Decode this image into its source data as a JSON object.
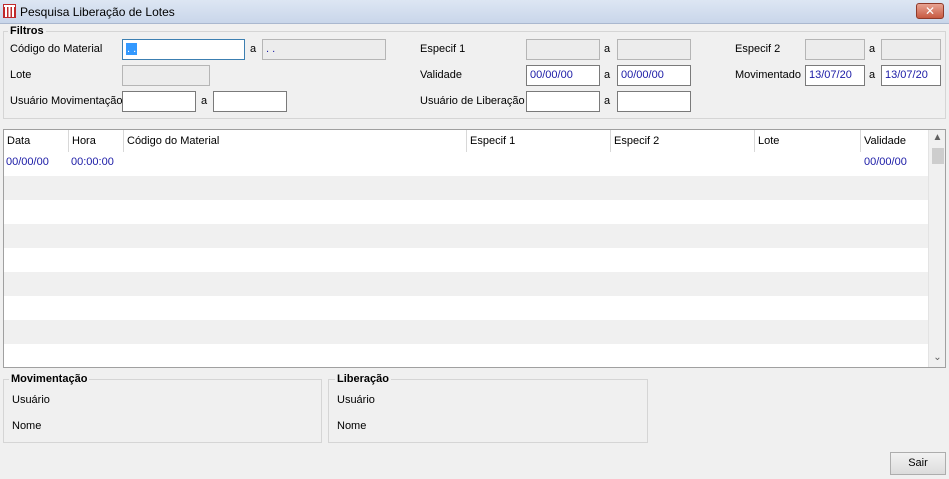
{
  "window": {
    "title": "Pesquisa Liberação de Lotes",
    "close_glyph": "✕"
  },
  "filtros": {
    "title": "Filtros",
    "connector": "a",
    "codigo_material": {
      "label": "Código do Material",
      "from": ". .",
      "to": ". ."
    },
    "lote": {
      "label": "Lote",
      "value": ""
    },
    "usuario_movimentacao": {
      "label": "Usuário Movimentação",
      "from": "",
      "to": ""
    },
    "especif1": {
      "label": "Especif 1",
      "from": "",
      "to": ""
    },
    "validade": {
      "label": "Validade",
      "from": "00/00/00",
      "to": "00/00/00"
    },
    "usuario_liberacao": {
      "label": "Usuário de Liberação",
      "from": "",
      "to": ""
    },
    "especif2": {
      "label": "Especif 2",
      "from": "",
      "to": ""
    },
    "movimentado": {
      "label": "Movimentado",
      "from": "13/07/20",
      "to": "13/07/20"
    }
  },
  "grid": {
    "columns": [
      "Data",
      "Hora",
      "Código do Material",
      "Especif 1",
      "Especif 2",
      "Lote",
      "Validade"
    ],
    "rows": [
      {
        "data": "00/00/00",
        "hora": "00:00:00",
        "codigo": "",
        "especif1": "",
        "especif2": "",
        "lote": "",
        "validade": "00/00/00"
      }
    ],
    "scroll_up": "▲",
    "scroll_down": "⌄"
  },
  "movimentacao": {
    "title": "Movimentação",
    "usuario_label": "Usuário",
    "nome_label": "Nome"
  },
  "liberacao": {
    "title": "Liberação",
    "usuario_label": "Usuário",
    "nome_label": "Nome"
  },
  "buttons": {
    "sair": "Sair"
  },
  "colors": {
    "value_text": "#1a1aa6",
    "selection": "#3399ff",
    "alt_row": "#f0f0f0"
  }
}
